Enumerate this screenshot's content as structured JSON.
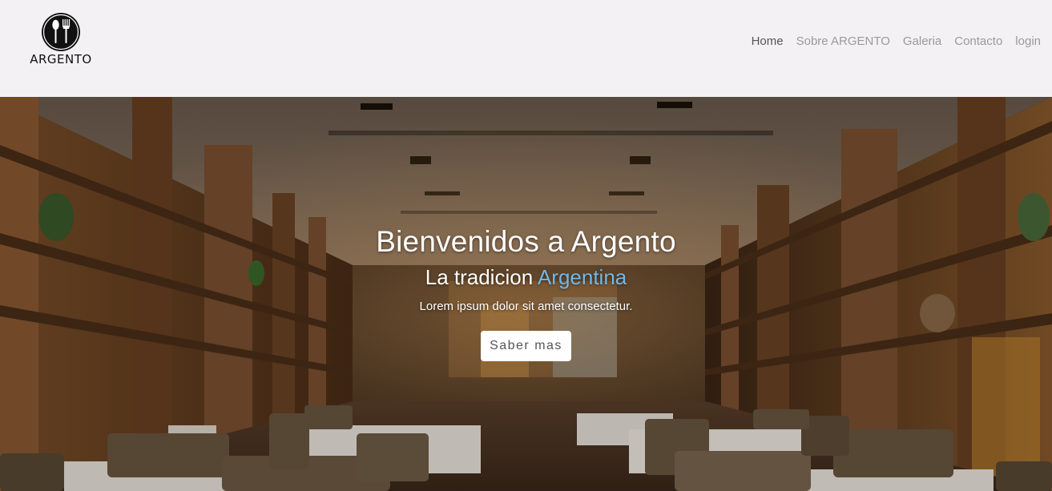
{
  "brand": {
    "name": "ARGENTO",
    "logo_icon": "fork-and-spoon-icon"
  },
  "nav": {
    "items": [
      {
        "label": "Home",
        "active": true
      },
      {
        "label": "Sobre ARGENTO",
        "active": false
      },
      {
        "label": "Galeria",
        "active": false
      },
      {
        "label": "Contacto",
        "active": false
      },
      {
        "label": "login",
        "active": false
      }
    ]
  },
  "hero": {
    "title": "Bienvenidos a Argento",
    "subtitle_prefix": "La tradicion",
    "subtitle_accent": "Argentina",
    "text": "Lorem ipsum dolor sit amet consectetur.",
    "button_label": "Saber mas",
    "background": "restaurant-interior-photo"
  },
  "colors": {
    "navbar_bg": "#f3f1f4",
    "accent": "#72b8e8",
    "nav_active": "#555555",
    "nav_inactive": "#9a9a9a"
  }
}
